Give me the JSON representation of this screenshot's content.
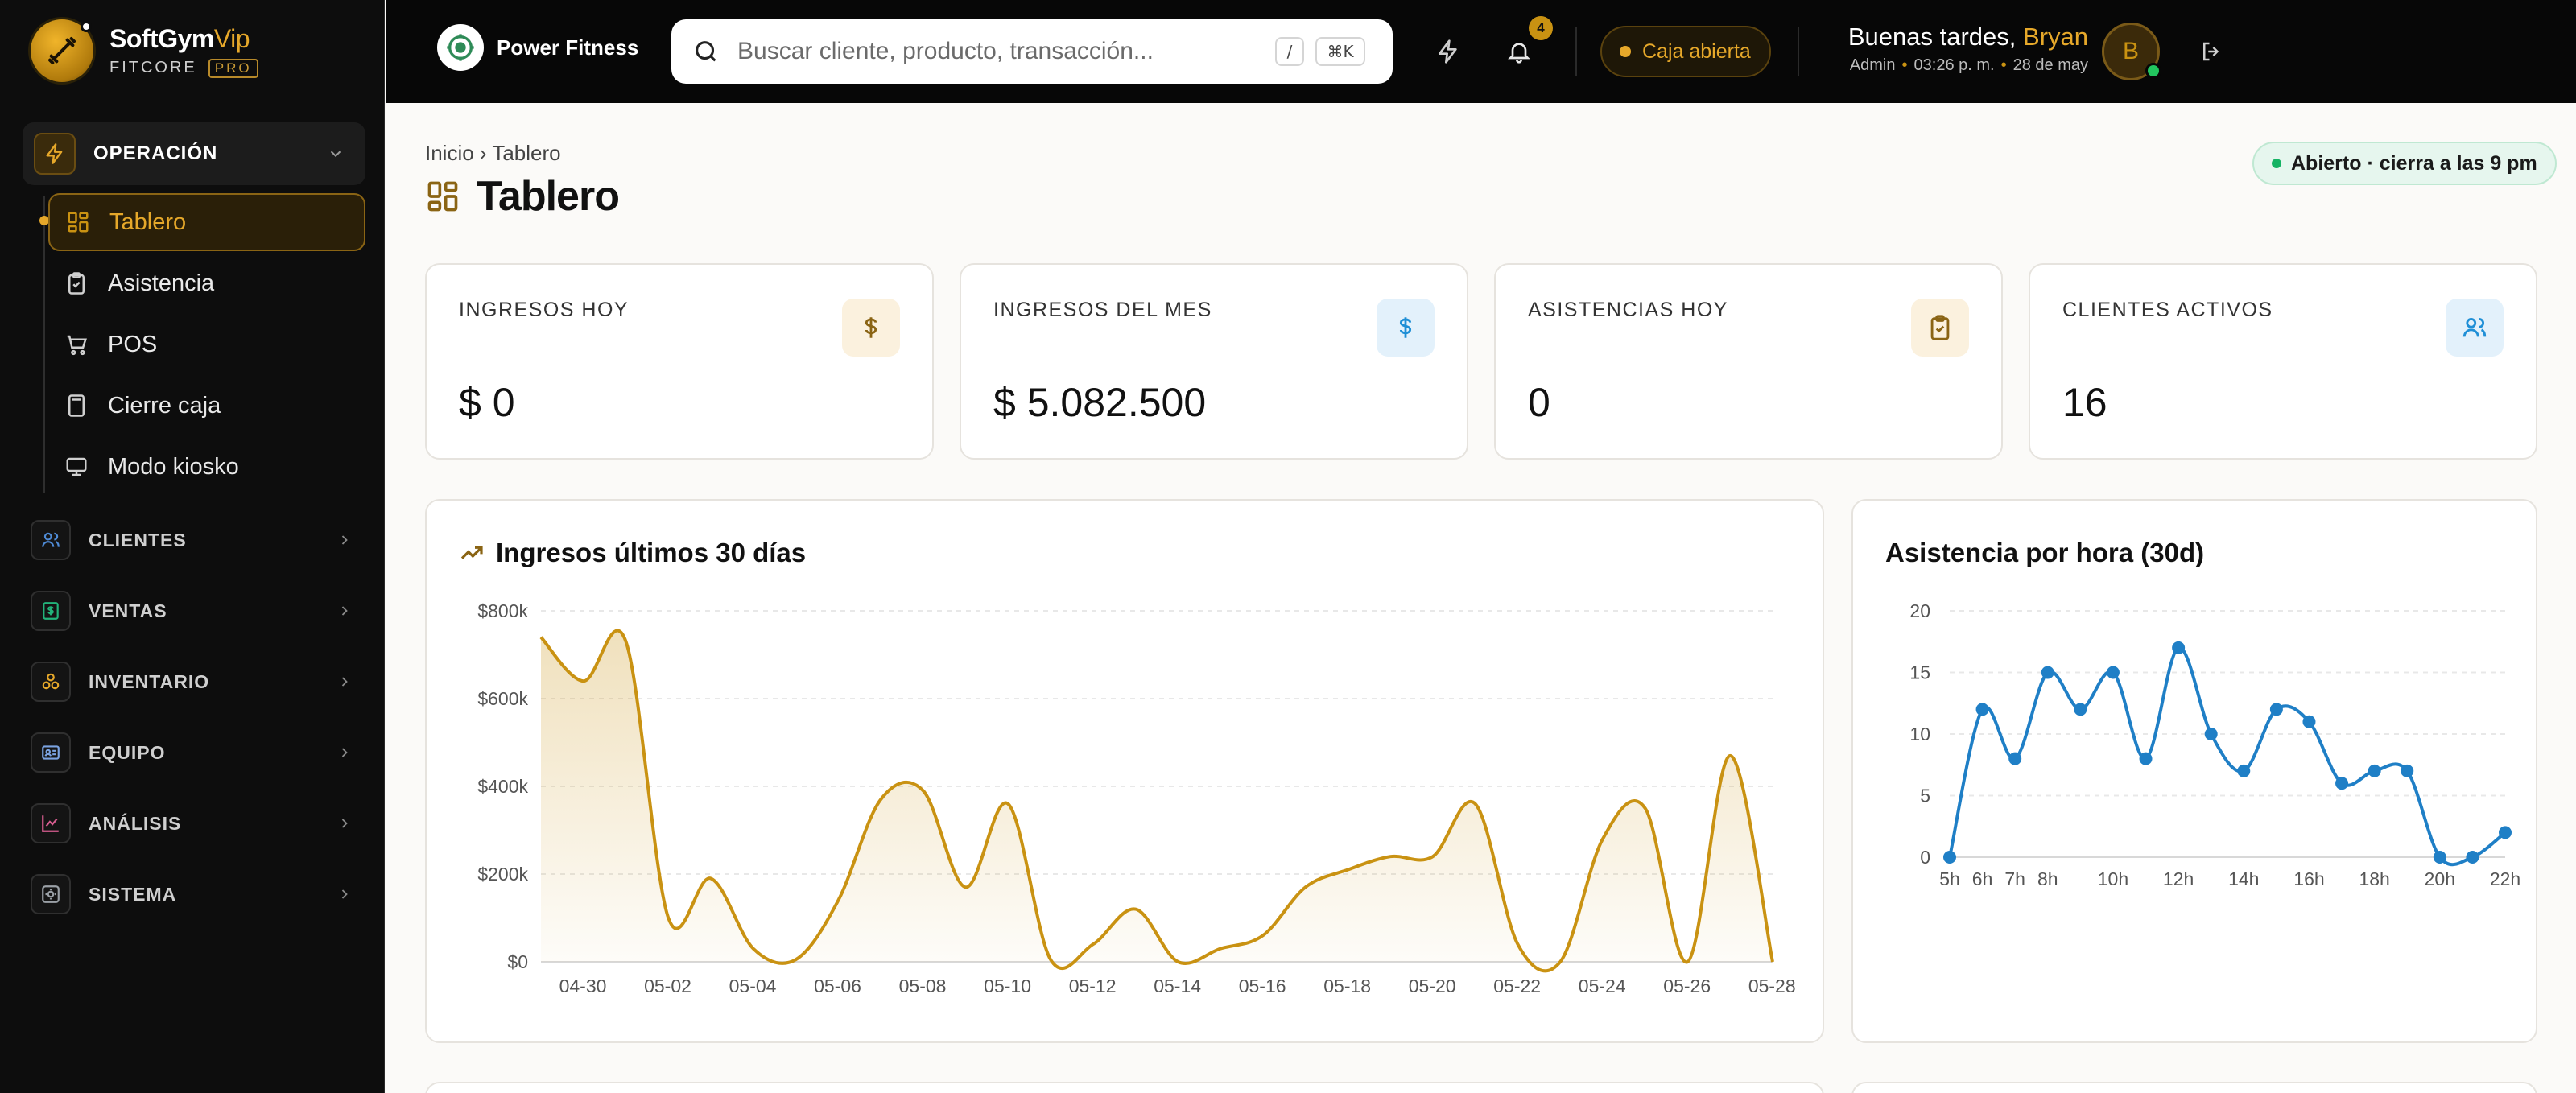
{
  "brand": {
    "name": "SoftGym",
    "name_accent": "Vip",
    "sub": "FITCORE",
    "badge": "PRO"
  },
  "sidebar": {
    "open_group": {
      "label": "OPERACIÓN"
    },
    "sub_items": [
      {
        "label": "Tablero",
        "active": true,
        "icon": "grid-icon"
      },
      {
        "label": "Asistencia",
        "icon": "clipboard-check-icon"
      },
      {
        "label": "POS",
        "icon": "cart-icon"
      },
      {
        "label": "Cierre caja",
        "icon": "calculator-icon"
      },
      {
        "label": "Modo kiosko",
        "icon": "monitor-icon"
      }
    ],
    "groups": [
      {
        "label": "CLIENTES",
        "icon": "users-icon",
        "color": "#4f8bd6"
      },
      {
        "label": "VENTAS",
        "icon": "dollar-receipt-icon",
        "color": "#22b37a"
      },
      {
        "label": "INVENTARIO",
        "icon": "boxes-icon",
        "color": "#e6a82a"
      },
      {
        "label": "EQUIPO",
        "icon": "id-card-icon",
        "color": "#7aa2e0"
      },
      {
        "label": "ANÁLISIS",
        "icon": "chart-line-icon",
        "color": "#d65c8f"
      },
      {
        "label": "SISTEMA",
        "icon": "system-icon",
        "color": "#9aa0a6"
      }
    ]
  },
  "topbar": {
    "org_name": "Power Fitness",
    "search_placeholder": "Buscar cliente, producto, transacción...",
    "kbd_slash": "/",
    "kbd_cmd": "⌘K",
    "notif_count": "4",
    "caja_label": "Caja abierta",
    "greeting": "Buenas tardes,",
    "user_name": "Bryan",
    "role": "Admin",
    "time": "03:26 p. m.",
    "date": "28 de may",
    "avatar_initial": "B"
  },
  "main": {
    "breadcrumb": "Inicio › Tablero",
    "title": "Tablero",
    "status": "Abierto · cierra a las 9 pm",
    "kpis": [
      {
        "label": "INGRESOS HOY",
        "value": "$ 0",
        "icon": "dollar-icon",
        "color": "#c99212",
        "bg": "#fbf1de"
      },
      {
        "label": "INGRESOS DEL MES",
        "value": "$ 5.082.500",
        "icon": "dollar-icon",
        "color": "#1f8fd6",
        "bg": "#e3f1fb"
      },
      {
        "label": "ASISTENCIAS HOY",
        "value": "0",
        "icon": "clipboard-check-icon",
        "color": "#8a6414",
        "bg": "#fbf1de"
      },
      {
        "label": "CLIENTES ACTIVOS",
        "value": "16",
        "icon": "users-icon",
        "color": "#1f8fd6",
        "bg": "#e3f1fb"
      }
    ],
    "income_card": {
      "title": "Ingresos últimos 30 días"
    },
    "attendance_card": {
      "title": "Asistencia por hora (30d)"
    }
  },
  "chart_data": [
    {
      "type": "area",
      "title": "Ingresos últimos 30 días",
      "color": "#c99212",
      "y_ticks": [
        "$0",
        "$200k",
        "$400k",
        "$600k",
        "$800k"
      ],
      "ylim": [
        0,
        800000
      ],
      "x_ticks": [
        "04-30",
        "05-02",
        "05-04",
        "05-06",
        "05-08",
        "05-10",
        "05-12",
        "05-14",
        "05-16",
        "05-18",
        "05-20",
        "05-22",
        "05-24",
        "05-26",
        "05-28"
      ],
      "grid": true,
      "series": [
        {
          "values": [
            740000,
            640000,
            730000,
            100000,
            190000,
            30000,
            5000,
            140000,
            370000,
            390000,
            170000,
            360000,
            5000,
            40000,
            120000,
            0,
            30000,
            60000,
            170000,
            210000,
            240000,
            240000,
            360000,
            40000,
            0,
            280000,
            350000,
            0,
            470000,
            0
          ]
        }
      ]
    },
    {
      "type": "line",
      "title": "Asistencia por hora (30d)",
      "color": "#1f7fc6",
      "y_ticks": [
        "0",
        "5",
        "10",
        "15",
        "20"
      ],
      "ylim": [
        0,
        20
      ],
      "categories": [
        "5h",
        "",
        "6h",
        "",
        "7h",
        "",
        "8h",
        "",
        "",
        "10h",
        "",
        "12h",
        "",
        "14h",
        "",
        "16h",
        "",
        "18h",
        "",
        "20h",
        "",
        "22h"
      ],
      "x_ticks": [
        "5h",
        "6h",
        "7h",
        "8h",
        "10h",
        "12h",
        "14h",
        "16h",
        "18h",
        "20h",
        "22h"
      ],
      "grid": true,
      "series": [
        {
          "values": [
            0,
            12,
            8,
            15,
            12,
            15,
            8,
            17,
            10,
            7,
            12,
            11,
            6,
            7,
            7,
            0,
            0,
            2
          ]
        }
      ]
    }
  ]
}
